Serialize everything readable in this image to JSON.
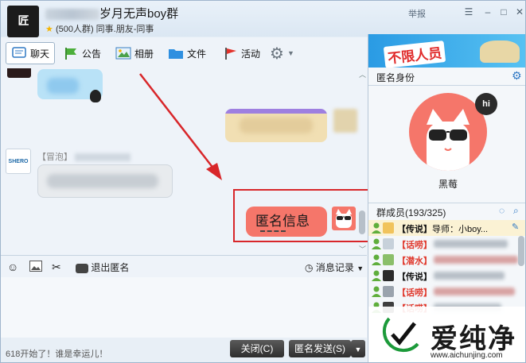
{
  "header": {
    "avatar_text": "匠",
    "title": "岁月无声boy群",
    "group_meta": "(500人群) 同事.朋友-同事",
    "report": "举报"
  },
  "toolbar": {
    "chat": "聊天",
    "notice": "公告",
    "album": "相册",
    "file": "文件",
    "activity": "活动"
  },
  "chat": {
    "nickname_prefix": "【冒泡】",
    "anon_message": "匿名信息"
  },
  "input_bar": {
    "exit_anon": "退出匿名",
    "history": "消息记录"
  },
  "footer": {
    "tip": "618开始了！谁是幸运儿！",
    "close": "关闭(C)",
    "send": "匿名发送(S)"
  },
  "right_panel": {
    "banner": "不限人员",
    "anon_identity_title": "匿名身份",
    "anon_name": "黑莓",
    "member_title": "群成员(193/325)",
    "members": [
      {
        "role": "【传说】",
        "name": "导师：小boy...",
        "role_color": "#111111"
      },
      {
        "role": "【话唠】",
        "name": "",
        "role_color": "#e03a2e"
      },
      {
        "role": "【潜水】",
        "name": "",
        "role_color": "#e03a2e"
      },
      {
        "role": "【传说】",
        "name": "",
        "role_color": "#111111"
      },
      {
        "role": "【话唠】",
        "name": "",
        "role_color": "#e03a2e"
      },
      {
        "role": "【话唠】",
        "name": "",
        "role_color": "#e03a2e"
      }
    ]
  },
  "watermark": {
    "text": "爱纯净",
    "url": "www.aichunjing.com"
  },
  "colors": {
    "anon_accent": "#f5766a",
    "highlight": "#d8262a"
  }
}
